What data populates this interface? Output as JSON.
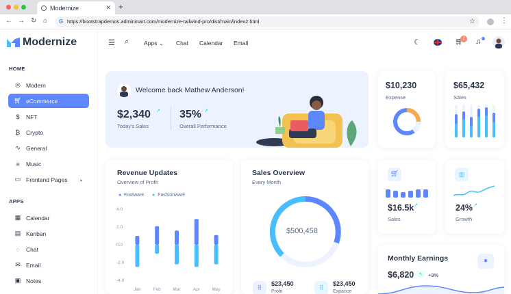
{
  "browser": {
    "tab_title": "Modernize",
    "url": "https://bootstrapdemos.adminmart.com/modernize-tailwind-pro/dist/main/index2.html"
  },
  "app": {
    "name": "Modernize",
    "accent": "#5d87ff"
  },
  "sidebar": {
    "home_label": "HOME",
    "apps_label": "APPS",
    "home_items": [
      {
        "label": "Modern",
        "icon": "aperture-icon"
      },
      {
        "label": "eCommerce",
        "icon": "cart-icon"
      },
      {
        "label": "NFT",
        "icon": "currency-icon"
      },
      {
        "label": "Crypto",
        "icon": "crypto-icon"
      },
      {
        "label": "General",
        "icon": "activity-icon"
      },
      {
        "label": "Music",
        "icon": "playlist-icon"
      },
      {
        "label": "Frontend Pages",
        "icon": "layout-icon"
      }
    ],
    "app_items": [
      {
        "label": "Calendar",
        "icon": "calendar-icon"
      },
      {
        "label": "Kanban",
        "icon": "kanban-icon"
      },
      {
        "label": "Chat",
        "icon": "chat-icon"
      },
      {
        "label": "Email",
        "icon": "mail-icon"
      },
      {
        "label": "Notes",
        "icon": "notes-icon"
      }
    ]
  },
  "topbar": {
    "apps": "Apps",
    "chat": "Chat",
    "calendar": "Calendar",
    "email": "Email",
    "cart_count": "2"
  },
  "welcome": {
    "title": "Welcome back Mathew Anderson!",
    "sales_value": "$2,340",
    "sales_label": "Today's Sales",
    "perf_value": "35%",
    "perf_label": "Overall Performance"
  },
  "expense": {
    "value": "$10,230",
    "label": "Expense"
  },
  "sales_card": {
    "value": "$65,432",
    "label": "Sales"
  },
  "revenue": {
    "title": "Revenue Updates",
    "subtitle": "Overview of Profit",
    "legend": [
      "Footware",
      "Fashionware"
    ]
  },
  "sales_overview": {
    "title": "Sales Overview",
    "subtitle": "Every Month",
    "center": "$500,458",
    "profit_value": "$23,450",
    "profit_label": "Profit",
    "expense_value": "$23,450",
    "expense_label": "Expance"
  },
  "small_sales": {
    "value": "$16.5k",
    "label": "Sales"
  },
  "growth": {
    "value": "24%",
    "label": "Growth"
  },
  "monthly": {
    "title": "Monthly Earnings",
    "value": "$6,820",
    "change": "+9%"
  },
  "chart_data": {
    "type": "bar",
    "categories": [
      "Jan",
      "Feb",
      "Mar",
      "Apr",
      "May"
    ],
    "yticks": [
      "4.0",
      "2.0",
      "0.0",
      "-2.0",
      "-4.0"
    ],
    "ylim": [
      -4,
      4
    ],
    "series": [
      {
        "name": "Footware",
        "values": [
          1.0,
          2.1,
          1.6,
          2.9,
          1.1
        ],
        "color": "#5d87ff"
      },
      {
        "name": "Fashionware",
        "values": [
          -2.5,
          -1.0,
          -2.2,
          -2.5,
          -2.2
        ],
        "color": "#49beff"
      }
    ]
  }
}
